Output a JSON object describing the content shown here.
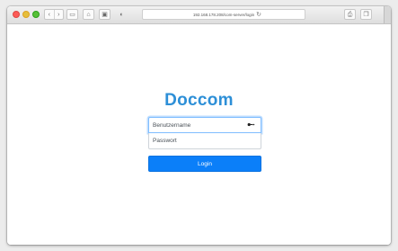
{
  "browser": {
    "url": "192.168.178.208/com-server/login",
    "back_glyph": "‹",
    "forward_glyph": "›",
    "sidebar_glyph": "▭",
    "home_glyph": "⌂",
    "extension_glyph": "▣",
    "privacy_glyph": "◐",
    "reload_glyph": "↻",
    "share_glyph": "⎙",
    "tabs_glyph": "❐"
  },
  "login": {
    "title": "Doccom",
    "username_placeholder": "Benutzername",
    "password_placeholder": "Passwort",
    "button_label": "Login",
    "password_manager_glyph": "🔑"
  },
  "colors": {
    "title": "#2d8fd7",
    "button": "#0b7ff9",
    "focus_ring": "#80bdff"
  }
}
